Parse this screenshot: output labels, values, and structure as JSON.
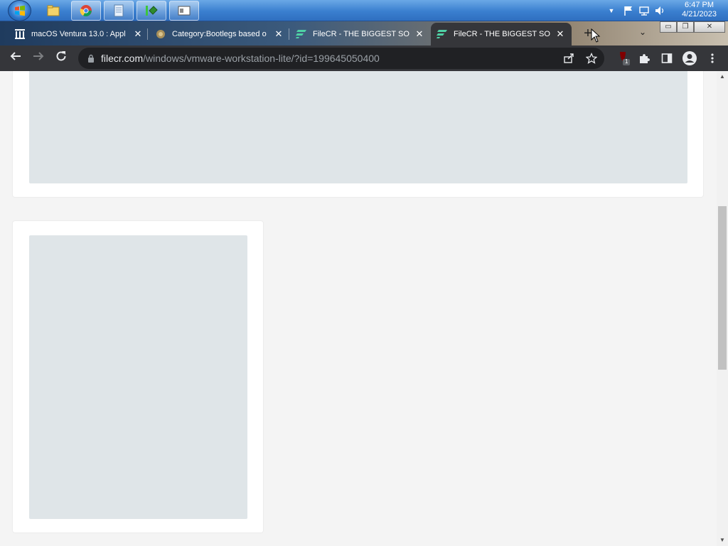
{
  "taskbar": {
    "start_icon": "windows-orb-icon",
    "pinned": [
      {
        "name": "file-explorer-icon"
      },
      {
        "name": "chrome-icon"
      },
      {
        "name": "notepad-icon"
      },
      {
        "name": "network-app-icon"
      },
      {
        "name": "window-app-icon"
      }
    ],
    "tray_icons": [
      "chevron-up-icon",
      "flag-icon",
      "network-icon",
      "volume-icon"
    ],
    "clock": {
      "time": "6:47 PM",
      "date": "4/21/2023"
    }
  },
  "browser": {
    "tabs": [
      {
        "title": "macOS Ventura 13.0 : Appl",
        "favicon": "archive-org-icon",
        "active": false
      },
      {
        "title": "Category:Bootlegs based o",
        "favicon": "wiki-icon",
        "active": false
      },
      {
        "title": "FileCR - THE BIGGEST SOF",
        "favicon": "filecr-icon",
        "active": false
      },
      {
        "title": "FileCR - THE BIGGEST SOF",
        "favicon": "filecr-icon",
        "active": true
      }
    ],
    "new_tab_label": "+",
    "omnibox": {
      "host": "filecr.com",
      "path": "/windows/vmware-workstation-lite/?id=199645050400"
    },
    "extension_badge": "1",
    "colors": {
      "tab_active": "#35363a",
      "toolbar": "#35363a",
      "omnibox": "#202124"
    }
  },
  "page": {
    "background": "#f4f4f4",
    "placeholder_color": "#dfe5e8"
  }
}
